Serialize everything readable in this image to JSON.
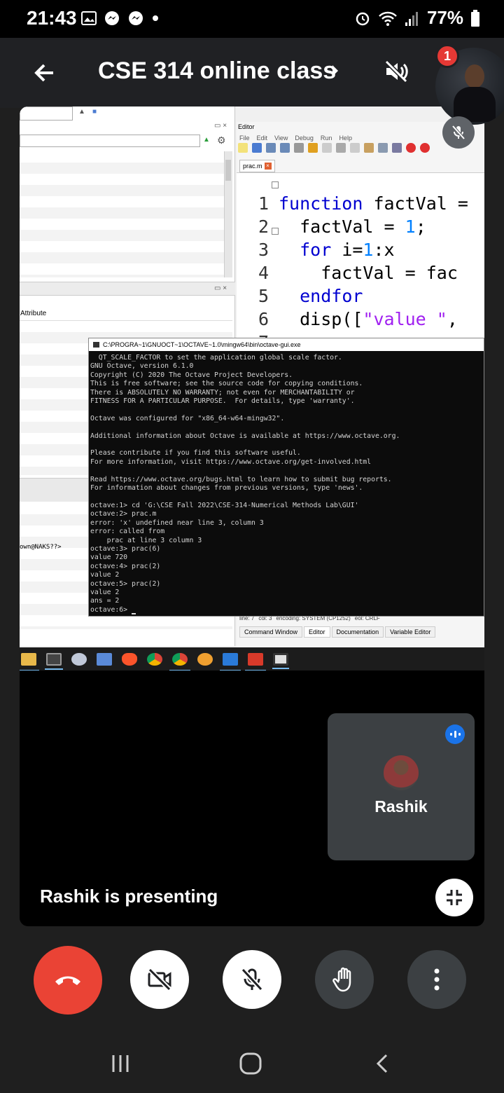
{
  "status_bar": {
    "time": "21:43",
    "battery": "77%",
    "icons": [
      "image-icon",
      "messenger-icon",
      "messenger-icon",
      "dot-icon",
      "alarm-icon",
      "wifi-icon",
      "signal-icon",
      "battery-icon"
    ]
  },
  "meeting": {
    "title": "CSE 314 online class",
    "notification_count": "1",
    "presenter_text": "Rashik is presenting"
  },
  "participant": {
    "name": "Rashik"
  },
  "shared_screen": {
    "left_panel": {
      "attribute_label": "Attribute",
      "history_text": "own@NAKS??>"
    },
    "editor": {
      "title": "Editor",
      "menu": [
        "File",
        "Edit",
        "View",
        "Debug",
        "Run",
        "Help"
      ],
      "tab": "prac.m",
      "lines": [
        {
          "n": "1",
          "code": "function factVal ="
        },
        {
          "n": "2",
          "code": "  factVal = 1;"
        },
        {
          "n": "3",
          "code": "  for i=1:x"
        },
        {
          "n": "4",
          "code": "    factVal = fac"
        },
        {
          "n": "5",
          "code": "  endfor"
        },
        {
          "n": "6",
          "code": "  disp([\"value \","
        },
        {
          "n": "7",
          "code": ""
        }
      ],
      "status": [
        "line: 7",
        "col: 3",
        "encoding: SYSTEM (CP1252)",
        "eol: CRLF"
      ],
      "bottom_tabs": [
        "Command Window",
        "Editor",
        "Documentation",
        "Variable Editor"
      ]
    },
    "console": {
      "title": "C:\\PROGRA~1\\GNUOCT~1\\OCTAVE~1.0\\mingw64\\bin\\octave-gui.exe",
      "text": "  QT_SCALE_FACTOR to set the application global scale factor.\nGNU Octave, version 6.1.0\nCopyright (C) 2020 The Octave Project Developers.\nThis is free software; see the source code for copying conditions.\nThere is ABSOLUTELY NO WARRANTY; not even for MERCHANTABILITY or\nFITNESS FOR A PARTICULAR PURPOSE.  For details, type 'warranty'.\n\nOctave was configured for \"x86_64-w64-mingw32\".\n\nAdditional information about Octave is available at https://www.octave.org.\n\nPlease contribute if you find this software useful.\nFor more information, visit https://www.octave.org/get-involved.html\n\nRead https://www.octave.org/bugs.html to learn how to submit bug reports.\nFor information about changes from previous versions, type 'news'.\n\noctave:1> cd 'G:\\CSE Fall 2022\\CSE-314-Numerical Methods Lab\\GUI'\noctave:2> prac.m\nerror: 'x' undefined near line 3, column 3\nerror: called from\n    prac at line 3 column 3\noctave:3> prac(6)\nvalue 720\noctave:4> prac(2)\nvalue 2\noctave:5> prac(2)\nvalue 2\nans = 2\noctave:6> "
    }
  },
  "controls": {
    "end_call": "phone-hangup-icon",
    "camera": "camera-off-icon",
    "mic": "mic-off-icon",
    "hand": "raise-hand-icon",
    "more": "more-vert-icon"
  },
  "colors": {
    "end_call": "#ea4335",
    "speaking": "#1a73e8",
    "badge": "#e53935"
  }
}
